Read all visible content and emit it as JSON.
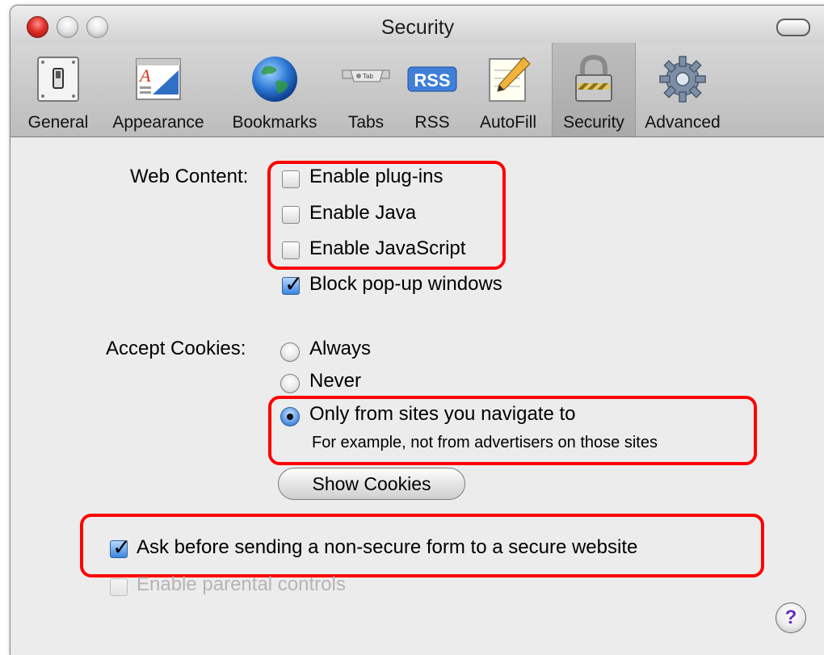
{
  "window": {
    "title": "Security"
  },
  "toolbar": {
    "items": [
      {
        "label": "General",
        "icon": "light-switch-icon"
      },
      {
        "label": "Appearance",
        "icon": "appearance-icon"
      },
      {
        "label": "Bookmarks",
        "icon": "globe-icon"
      },
      {
        "label": "Tabs",
        "icon": "tab-icon"
      },
      {
        "label": "RSS",
        "icon": "rss-icon"
      },
      {
        "label": "AutoFill",
        "icon": "pencil-note-icon"
      },
      {
        "label": "Security",
        "icon": "padlock-icon",
        "selected": true
      },
      {
        "label": "Advanced",
        "icon": "gear-icon"
      }
    ],
    "tab_icon_text": "Tab",
    "rss_icon_text": "RSS"
  },
  "web_content": {
    "label": "Web Content:",
    "options": [
      {
        "label": "Enable plug-ins",
        "checked": false
      },
      {
        "label": "Enable Java",
        "checked": false
      },
      {
        "label": "Enable JavaScript",
        "checked": false
      },
      {
        "label": "Block pop-up windows",
        "checked": true
      }
    ]
  },
  "cookies": {
    "label": "Accept Cookies:",
    "options": [
      {
        "label": "Always",
        "selected": false
      },
      {
        "label": "Never",
        "selected": false
      },
      {
        "label": "Only from sites you navigate to",
        "selected": true,
        "note": "For example, not from advertisers on those sites"
      }
    ],
    "show_button": "Show Cookies"
  },
  "ask_form": {
    "label": "Ask before sending a non-secure form to a secure website",
    "checked": true
  },
  "parental": {
    "label": "Enable parental controls",
    "checked": false,
    "disabled": true
  },
  "help_button": "?",
  "colors": {
    "highlight": "#ff0000",
    "checkbox_checked": "#3b86e0"
  }
}
